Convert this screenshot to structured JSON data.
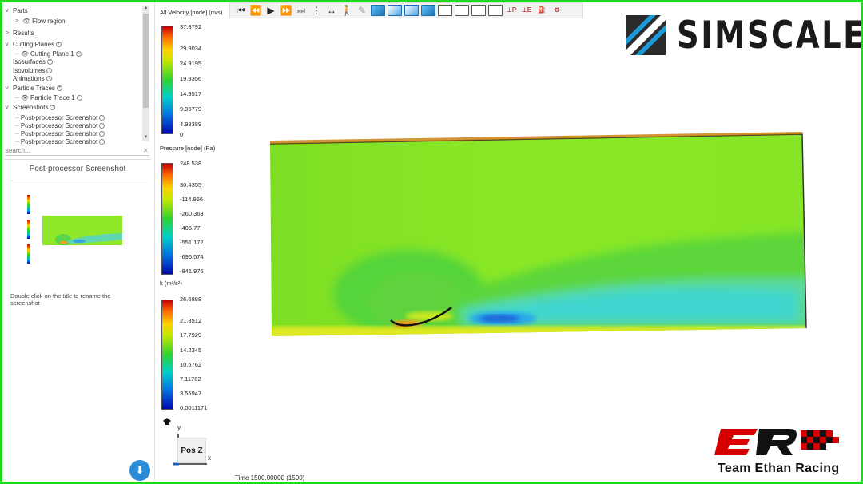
{
  "tree": {
    "items": [
      {
        "label": "Parts",
        "chevron": "v"
      },
      {
        "label": "Flow region",
        "chevron": ">"
      },
      {
        "label": "Results",
        "chevron": ">"
      },
      {
        "label": "Cutting Planes",
        "chevron": "v"
      },
      {
        "label": "Cutting Plane 1"
      },
      {
        "label": "Isosurfaces"
      },
      {
        "label": "Isovolumes"
      },
      {
        "label": "Animations"
      },
      {
        "label": "Particle Traces",
        "chevron": "v"
      },
      {
        "label": "Particle Trace 1"
      },
      {
        "label": "Screenshots",
        "chevron": "v"
      },
      {
        "label": "Post-processor Screenshot"
      },
      {
        "label": "Post-processor Screenshot"
      },
      {
        "label": "Post-processor Screenshot"
      },
      {
        "label": "Post-processor Screenshot"
      }
    ],
    "search_placeholder": "search..."
  },
  "screenshot_panel": {
    "title": "Post-processor Screenshot",
    "hint": "Double click on the title to rename the screenshot"
  },
  "legends": [
    {
      "title": "All Velocity [node] (m/s)",
      "ticks": [
        "37.3792",
        "29.9034",
        "24.9195",
        "19.9356",
        "14.9517",
        "9.96779",
        "4.98389",
        "0"
      ]
    },
    {
      "title": "Pressure [node] (Pa)",
      "ticks": [
        "248.538",
        "30.4355",
        "-114.966",
        "-260.368",
        "-405.77",
        "-551.172",
        "-696.574",
        "-841.976"
      ]
    },
    {
      "title": "k (m²/s²)",
      "ticks": [
        "26.6888",
        "21.3512",
        "17.7929",
        "14.2345",
        "10.6762",
        "7.11782",
        "3.55947",
        "0.0011171"
      ]
    }
  ],
  "viewport": {
    "time_label": "Time 1500.00000 (1500)",
    "view_button": "Pos Z",
    "axis_y": "y",
    "axis_x": "x"
  },
  "branding": {
    "simscale": "SIMSCALE",
    "team": "Team Ethan Racing"
  },
  "colors": {
    "frame_border": "#1fd81f",
    "download_button": "#2a8bd6",
    "logo_red": "#d40000"
  }
}
